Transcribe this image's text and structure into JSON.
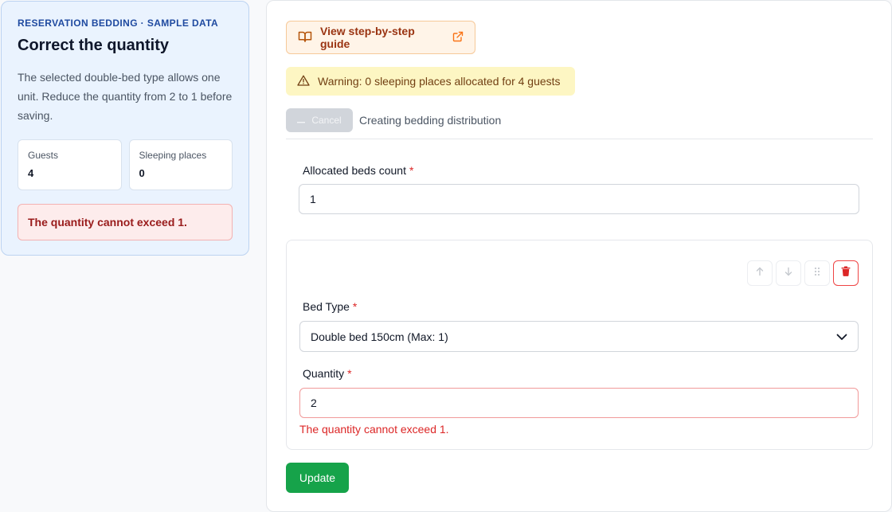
{
  "sidebar": {
    "eyebrow": "RESERVATION BEDDING · SAMPLE DATA",
    "title": "Correct the quantity",
    "description": "The selected double-bed type allows one unit. Reduce the quantity from 2 to 1 before saving.",
    "stats": [
      {
        "label": "Guests",
        "value": "4"
      },
      {
        "label": "Sleeping places",
        "value": "0"
      }
    ],
    "error": "The quantity cannot exceed 1.",
    "colors": {
      "background": "#eaf3fe",
      "accent": "#1f4aa0",
      "error": "#991b1b"
    }
  },
  "main": {
    "guide_button": {
      "label": "View step-by-step guide",
      "icon": "book-open-icon",
      "trailing_icon": "external-link-icon"
    },
    "warning": {
      "text": "Warning: 0 sleeping places allocated for 4 guests",
      "icon": "warning-triangle-icon"
    },
    "cancel_button": {
      "label": "Cancel",
      "icon": "minus-icon"
    },
    "status_text": "Creating bedding distribution",
    "allocated_beds": {
      "label": "Allocated beds count",
      "required_marker": "*",
      "value": "1"
    },
    "bed_item": {
      "actions": [
        {
          "name": "move-up",
          "icon": "arrow-up-icon"
        },
        {
          "name": "move-down",
          "icon": "arrow-down-icon"
        },
        {
          "name": "drag",
          "icon": "drag-handle-icon"
        },
        {
          "name": "delete",
          "icon": "trash-icon"
        }
      ],
      "bed_type": {
        "label": "Bed Type",
        "required_marker": "*",
        "value": "Double bed 150cm (Max: 1)"
      },
      "quantity": {
        "label": "Quantity",
        "required_marker": "*",
        "value": "2",
        "error": "The quantity cannot exceed 1."
      }
    },
    "update_button": {
      "label": "Update"
    },
    "colors": {
      "primary": "#16a34a",
      "danger": "#dc2626",
      "warning_bg": "#fdf6c3",
      "guide_bg": "#fff4e8"
    }
  }
}
